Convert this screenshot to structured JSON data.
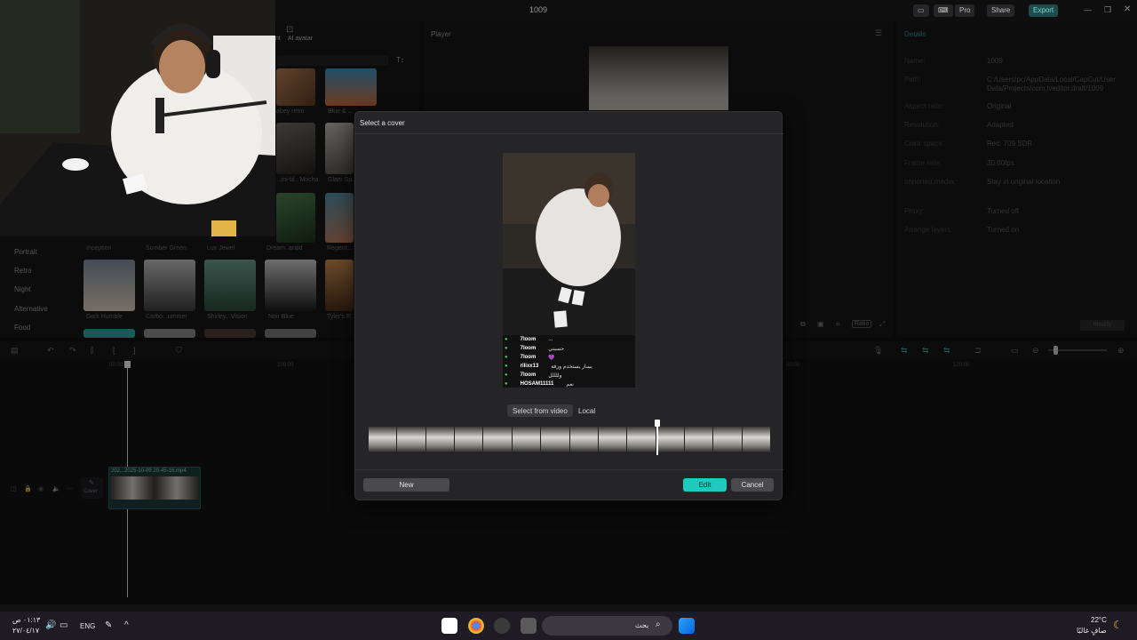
{
  "window": {
    "title": "1009",
    "pro": "Pro",
    "share": "Share",
    "export": "Export"
  },
  "media": {
    "tab_ai_avatar": "AI avatar",
    "categories": [
      "Portrait",
      "Retro",
      "Night",
      "Alternative",
      "Food"
    ],
    "thumbs_row1": [
      "abey retro",
      "Blue & ..."
    ],
    "thumbs_row2": [
      "...ini-bl.. Mocha",
      "Glam Sp..."
    ],
    "thumbs_row3": [
      "Inception",
      "Somber Green",
      "Lux Jewel",
      "Dream..arald",
      "Regent..."
    ],
    "thumbs_row4": [
      "Dark Humble",
      "Carbo...ummer",
      "Shirley...Vision",
      "Noir Blue",
      "Tyler's R..."
    ]
  },
  "player": {
    "title": "Player",
    "ratio_button": "Ratio"
  },
  "details": {
    "title": "Details",
    "rows": [
      {
        "label": "Name:",
        "value": "1009"
      },
      {
        "label": "Path:",
        "value": "C:/Users/pc/AppData/Local/CapCut/User Data/Projects/com.lveditor.draft/1009"
      },
      {
        "label": "Aspect ratio:",
        "value": "Original"
      },
      {
        "label": "Resolution:",
        "value": "Adapted"
      },
      {
        "label": "Color space:",
        "value": "Rec. 709 SDR"
      },
      {
        "label": "Frame rate:",
        "value": "30.00fps"
      },
      {
        "label": "Imported media:",
        "value": "Stay in original location"
      },
      {
        "label": "Proxy:",
        "value": "Turned off"
      },
      {
        "label": "Arrange layers:",
        "value": "Turned on"
      }
    ],
    "modify_button": "Modify"
  },
  "timeline": {
    "ticks": [
      "00:00",
      "100:00",
      "00:00",
      "120:00"
    ],
    "clip_label": "202...2025-10-09 20-45-16.mp4",
    "cover_label": "Cover"
  },
  "dialog": {
    "title": "Select a cover",
    "tab_select_from_video": "Select from video",
    "tab_local": "Local",
    "new_button": "New",
    "edit_button": "Edit",
    "cancel_button": "Cancel",
    "chat": [
      {
        "user": "7loom",
        "msg": "..."
      },
      {
        "user": "7loom",
        "msg": "حسيني"
      },
      {
        "user": "7loom",
        "msg": "💜"
      },
      {
        "user": "rilixx13",
        "msg": "يسار يستخدم ورقة"
      },
      {
        "user": "7loom",
        "msg": "وللللل"
      },
      {
        "user": "HOSAM11111",
        "msg": "نعم"
      }
    ]
  },
  "taskbar": {
    "time": "٠١:١٣ ص",
    "date": "٢٧/٠٤/١٧",
    "language": "ENG",
    "search_placeholder": "بحث",
    "weather_temp": "22°C",
    "weather_desc": "صافٍ غالبًا"
  },
  "colors": {
    "accent": "#20c8c0",
    "panel": "#161617",
    "dialog": "#252527"
  }
}
